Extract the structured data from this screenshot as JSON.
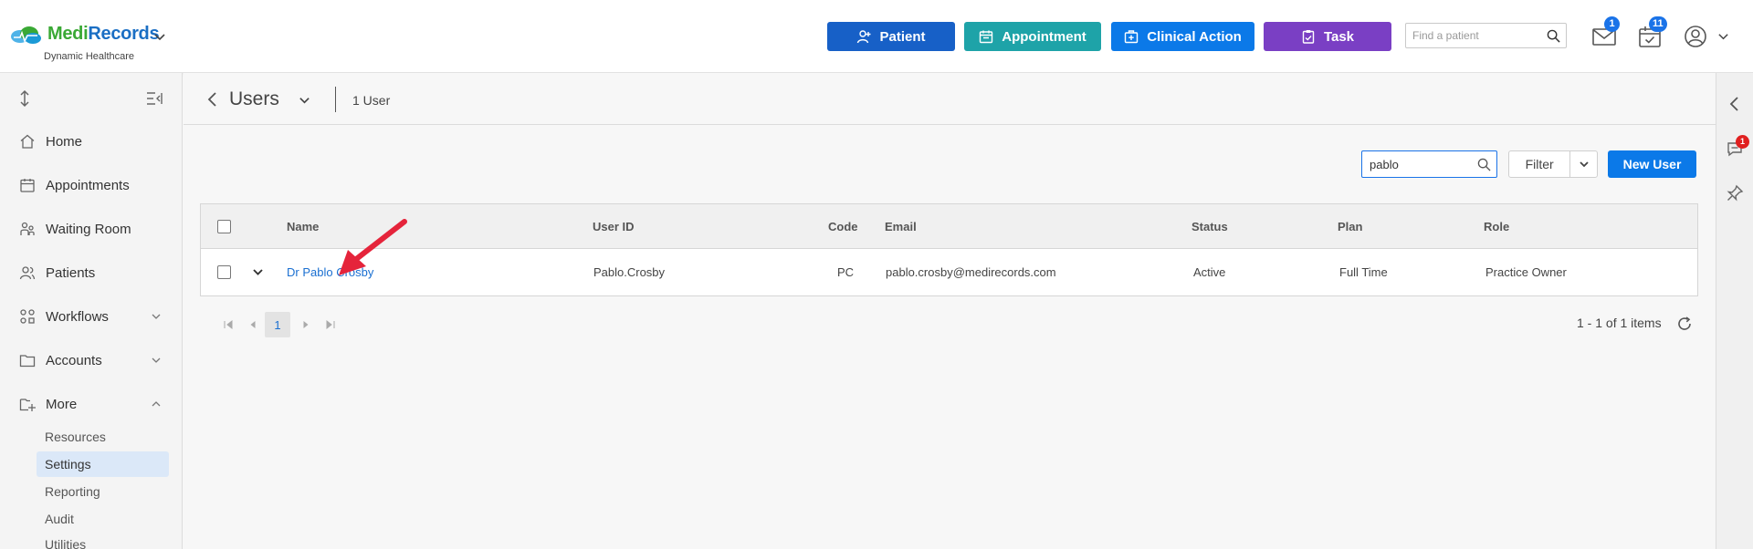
{
  "brand": {
    "name_part1": "Medi",
    "name_part2": "Records",
    "subtitle": "Dynamic Healthcare"
  },
  "header": {
    "buttons": {
      "patient": "Patient",
      "appointment": "Appointment",
      "clinical_action": "Clinical Action",
      "task": "Task"
    },
    "find_placeholder": "Find a patient",
    "messages_count": "1",
    "tasks_count": "11"
  },
  "sidebar": {
    "items": [
      {
        "label": "Home",
        "icon": "home-icon"
      },
      {
        "label": "Appointments",
        "icon": "calendar-icon"
      },
      {
        "label": "Waiting Room",
        "icon": "waiting-room-icon"
      },
      {
        "label": "Patients",
        "icon": "people-icon"
      },
      {
        "label": "Workflows",
        "icon": "workflow-icon"
      },
      {
        "label": "Accounts",
        "icon": "folder-icon"
      },
      {
        "label": "More",
        "icon": "folder-more-icon"
      }
    ],
    "more_subitems": [
      "Resources",
      "Settings",
      "Reporting",
      "Audit",
      "Utilities"
    ],
    "active_subitem": "Settings"
  },
  "page": {
    "title": "Users",
    "count": "1 User"
  },
  "toolbar": {
    "search_value": "pablo",
    "filter_label": "Filter",
    "new_user_label": "New User"
  },
  "table": {
    "columns": [
      "Name",
      "User ID",
      "Code",
      "Email",
      "Status",
      "Plan",
      "Role"
    ],
    "rows": [
      {
        "name": "Dr Pablo Crosby",
        "user_id": "Pablo.Crosby",
        "code": "PC",
        "email": "pablo.crosby@medirecords.com",
        "status": "Active",
        "plan": "Full Time",
        "role": "Practice Owner"
      }
    ]
  },
  "pager": {
    "current_page": "1",
    "info": "1 - 1 of 1 items"
  },
  "rail": {
    "notification_count": "1"
  },
  "colors": {
    "patient_button": "#1760c7",
    "appointment_button": "#1ea3a8",
    "clinical_action_button": "#0b79e8",
    "task_button": "#7a3fc4",
    "link": "#1a6fd1",
    "annotation_arrow": "#e5243b"
  }
}
